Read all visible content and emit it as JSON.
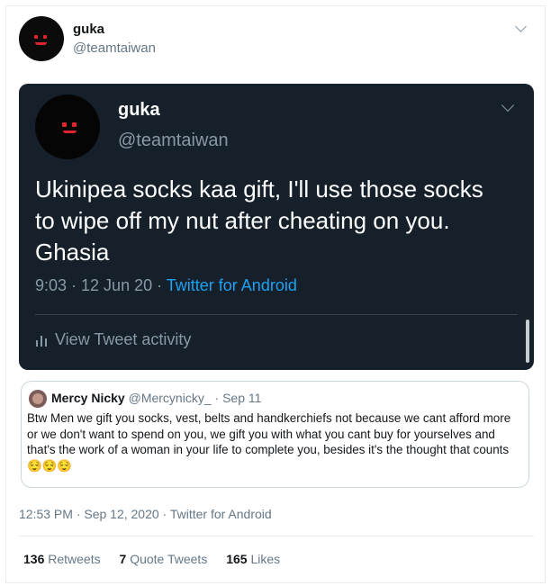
{
  "tweet": {
    "author_name": "guka",
    "author_handle": "@teamtaiwan",
    "timestamp": "12:53 PM · Sep 12, 2020 · Twitter for Android",
    "stats": {
      "retweets_count": "136",
      "retweets_label": "Retweets",
      "quote_count": "7",
      "quote_label": "Quote Tweets",
      "likes_count": "165",
      "likes_label": "Likes"
    }
  },
  "embedded_screenshot": {
    "author_name": "guka",
    "author_handle": "@teamtaiwan",
    "text": "Ukinipea socks kaa gift, I'll use those socks to wipe off my nut after cheating on you. Ghasia",
    "time": "9:03 · 12 Jun 20 · ",
    "source": "Twitter for Android",
    "activity_label": "View Tweet activity",
    "colors": {
      "background": "#15202b",
      "link": "#1da1f2"
    }
  },
  "quoted_tweet": {
    "author_name": "Mercy Nicky",
    "author_handle": "@Mercynicky_",
    "date": "· Sep 11",
    "text": "Btw Men we  gift you socks, vest, belts and handkerchiefs not because we cant afford more or we don't want to spend on you, we gift you with what you cant buy for yourselves and that's the work of a woman in your life to complete you, besides it's the thought that counts",
    "emoji": "😌😌😌"
  },
  "icons": {
    "more": "chevron-down-icon",
    "activity": "bar-chart-icon"
  }
}
